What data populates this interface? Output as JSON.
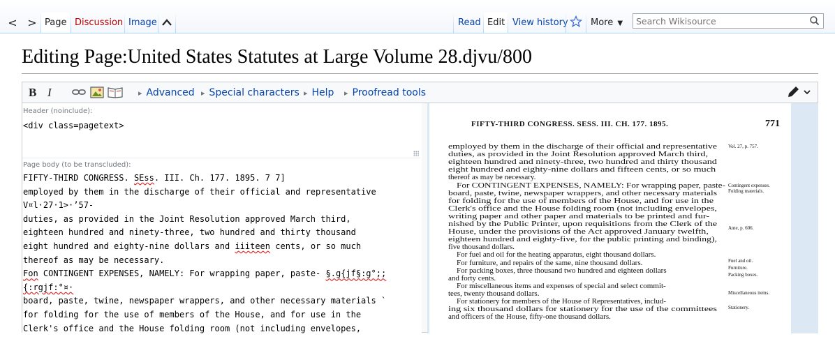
{
  "nav": {
    "back": "<",
    "forward": ">",
    "tabs": {
      "page": "Page",
      "discussion": "Discussion",
      "image": "Image"
    },
    "collapse": "^"
  },
  "views": {
    "read": "Read",
    "edit": "Edit",
    "history": "View history",
    "more": "More"
  },
  "search": {
    "placeholder": "Search Wikisource"
  },
  "title": "Editing Page:United States Statutes at Large Volume 28.djvu/800",
  "toolbar": {
    "bold": "B",
    "italic": "I",
    "advanced": "Advanced",
    "special": "Special characters",
    "help": "Help",
    "proofread": "Proofread tools"
  },
  "editor": {
    "header_label": "Header (noinclude):",
    "header_text": "<div class=pagetext>",
    "body_label": "Page body (to be transcluded):",
    "body_lines": [
      "FIFTY-THIRD CONGRESS. SEss. III. Ch. 177. 1895. 7 7]",
      "employed by them in the discharge of their official and representative",
      "V¤l·27·1>·’57-",
      "duties, as provided in the Joint Resolution approved March third,",
      "eighteen hundred and ninety-three, two hundred and thirty thousand",
      "eight hundred and eighty-nine dollars and iiiteen cents, or so much",
      "thereof as may be necessary.",
      "Fon CONTINGENT EXPENSES, NAMELY: For wrapping paper, paste- §.g{jf§:g°;;",
      "{:rgjf:°¤·",
      "board, paste, twine, newspaper wrappers, and other necessary materials `",
      "for folding for the use of members of the House, and for use in the",
      "Clerk's office and the House folding room (not including envelopes,"
    ]
  },
  "scan": {
    "header": "FIFTY-THIRD CONGRESS.  SESS. III.  CH. 177.  1895.",
    "page_number": "771",
    "lines": [
      "employed by them in the discharge of their official and representative",
      "duties, as provided in the Joint Resolution approved March third,",
      "eighteen hundred and ninety-three, two hundred and thirty thousand",
      "eight hundred and eighty-nine dollars and fifteen cents, or so much",
      "thereof as may be necessary.",
      "For CONTINGENT EXPENSES, NAMELY: For wrapping paper, paste-",
      "board, paste, twine, newspaper wrappers, and other necessary materials",
      "for folding for the use of members of the House, and for use in the",
      "Clerk's office and the House folding room (not including envelopes,",
      "writing paper and other paper and materials to be printed and fur-",
      "nished by the Public Printer, upon requisitions from the Clerk of the",
      "House, under the provisions of the Act approved January twelfth,",
      "eighteen hundred and eighty-five, for the public printing and binding),",
      "five thousand dollars.",
      "For fuel and oil for the heating apparatus, eight thousand dollars.",
      "For furniture, and repairs of the same, nine thousand dollars.",
      "For packing boxes, three thousand two hundred and eighteen dollars",
      "and forty cents.",
      "For miscellaneous items and expenses of special and select commit-",
      "tees, twenty thousand dollars.",
      "For stationery for members of the House of Representatives, includ-",
      "ing six thousand dollars for stationery for the use of the committees",
      "and officers of the House, fifty-one thousand dollars."
    ],
    "margin_notes": [
      "Vol. 27, p. 757.",
      "Contingent expenses.",
      "Folding materials.",
      "Ante, p. 606.",
      "Fuel and oil.",
      "Furniture.",
      "Packing boxes.",
      "Miscellaneous items.",
      "Stationery."
    ]
  }
}
